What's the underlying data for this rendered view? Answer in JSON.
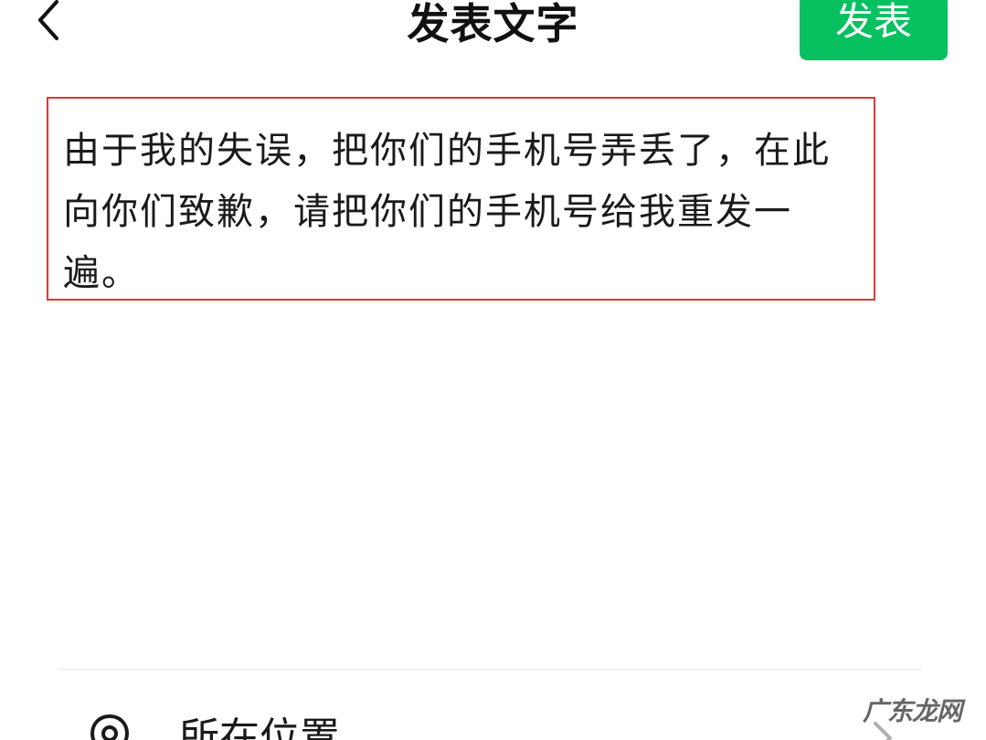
{
  "header": {
    "title": "发表文字",
    "publish_label": "发表"
  },
  "post": {
    "content": "由于我的失误，把你们的手机号弄丢了，在此向你们致歉，请把你们的手机号给我重发一遍。"
  },
  "location": {
    "label": "所在位置"
  },
  "watermark": {
    "text": "广东龙网"
  },
  "colors": {
    "accent": "#07c160",
    "highlight_border": "#e03535"
  },
  "icons": {
    "back": "chevron-left-icon",
    "location": "location-pin-icon",
    "forward": "chevron-right-icon"
  }
}
